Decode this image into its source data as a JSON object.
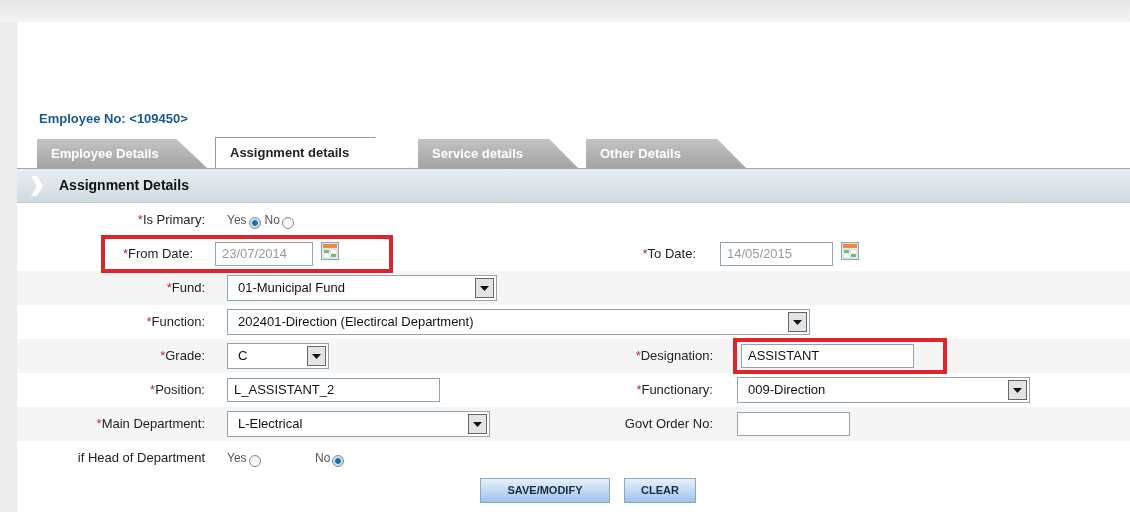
{
  "employee_no": "Employee No: <109450>",
  "tabs": [
    {
      "label": "Employee Details",
      "selected": false
    },
    {
      "label": "Assignment details",
      "selected": true
    },
    {
      "label": "Service details",
      "selected": false
    },
    {
      "label": "Other Details",
      "selected": false
    }
  ],
  "section_title": "Assignment Details",
  "rows": [
    {
      "left": {
        "kind": "radio",
        "label": "Is Primary:",
        "required_mark": "*",
        "options": [
          {
            "label": "Yes",
            "selected": true
          },
          {
            "label": "No",
            "selected": false
          }
        ]
      }
    },
    {
      "left": {
        "kind": "date",
        "label": "From Date:",
        "required_mark": "*",
        "value": "23/07/2014",
        "disabled": true,
        "highlighted": true
      },
      "right": {
        "kind": "date",
        "label": "To Date:",
        "required_mark": "*",
        "value": "14/05/2015",
        "disabled": true
      }
    },
    {
      "left": {
        "kind": "select",
        "label": "Fund:",
        "required_mark": "*",
        "value": "01-Municipal Fund"
      }
    },
    {
      "left": {
        "kind": "select",
        "label": "Function:",
        "required_mark": "*",
        "value": "202401-Direction (Electircal Department)"
      }
    },
    {
      "left": {
        "kind": "select",
        "label": "Grade:",
        "required_mark": "*",
        "value": "C"
      },
      "right": {
        "kind": "text",
        "label": "Designation:",
        "required_mark": "*",
        "value": "ASSISTANT",
        "highlighted": true
      }
    },
    {
      "left": {
        "kind": "text",
        "label": "Position:",
        "required_mark": "*",
        "value": "L_ASSISTANT_2"
      },
      "right": {
        "kind": "select",
        "label": "Functionary:",
        "required_mark": "*",
        "value": "009-Direction"
      }
    },
    {
      "left": {
        "kind": "select",
        "label": "Main Department:",
        "required_mark": "*",
        "value": "L-Electrical"
      },
      "right": {
        "kind": "text",
        "label": "Govt Order No:"
      }
    },
    {
      "left": {
        "kind": "radio",
        "label": "if Head of Department",
        "options": [
          {
            "label": "Yes",
            "selected": false
          },
          {
            "label": "No",
            "selected": true
          }
        ]
      }
    }
  ],
  "buttons": [
    "SAVE/MODIFY",
    "CLEAR"
  ]
}
